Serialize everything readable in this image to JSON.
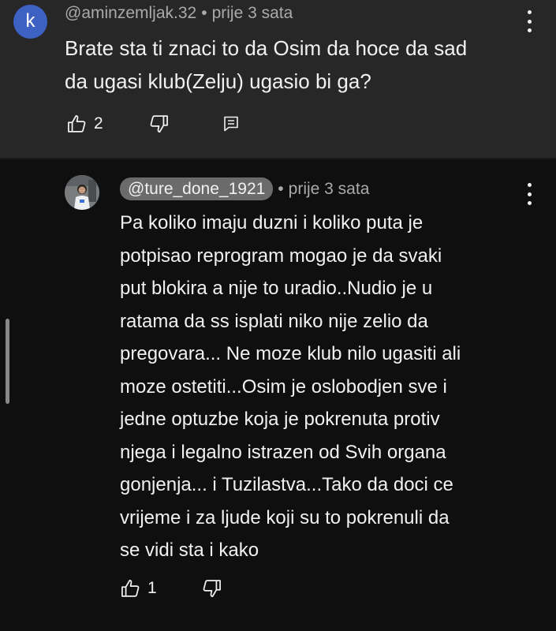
{
  "comment": {
    "avatar_letter": "k",
    "avatar_color": "#3e62c4",
    "author": "@aminzemljak.32",
    "separator": "•",
    "time": "prije 3 sata",
    "text_lines": [
      "Brate sta ti znaci to da Osim da hoce da sad",
      "da ugasi klub(Zelju) ugasio bi ga?"
    ],
    "like_count": "2",
    "icons": {
      "like": "thumb-up-icon",
      "dislike": "thumb-down-icon",
      "reply": "reply-icon",
      "menu": "more-vert-icon"
    }
  },
  "reply": {
    "author": "@ture_done_1921",
    "separator": "•",
    "time": "prije 3 sata",
    "text_lines": [
      "Pa koliko imaju duzni i koliko puta je",
      "potpisao reprogram mogao je da svaki",
      "put blokira a nije to uradio..Nudio je u",
      "ratama da ss isplati niko nije zelio da",
      "pregovara... Ne moze klub nilo ugasiti ali",
      "moze ostetiti...Osim je oslobodjen sve i",
      "jedne optuzbe koja je pokrenuta protiv",
      "njega i legalno istrazen od Svih organa",
      "gonjenja... i Tuzilastva...Tako da doci ce",
      "vrijeme i za ljude koji su to pokrenuli da",
      "se vidi sta i kako"
    ],
    "like_count": "1",
    "icons": {
      "like": "thumb-up-icon",
      "dislike": "thumb-down-icon",
      "menu": "more-vert-icon",
      "avatar": "avatar-photo"
    }
  },
  "colors": {
    "background": "#0f0f0f",
    "highlighted_comment": "#272727",
    "text": "#f1f1f1",
    "secondary_text": "#aaaaaa",
    "handle_pill": "#6b6b6b"
  }
}
